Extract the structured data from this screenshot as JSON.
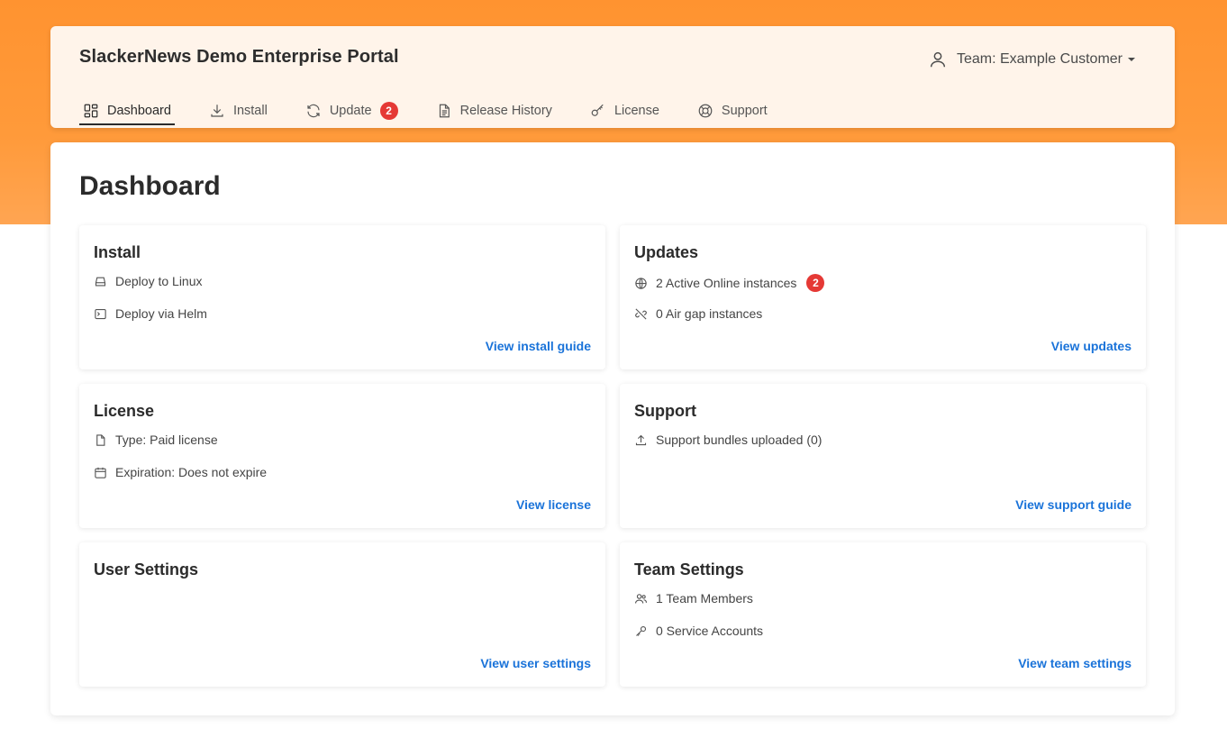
{
  "header": {
    "brand": "SlackerNews Demo Enterprise Portal",
    "team_label": "Team: Example Customer"
  },
  "nav": {
    "dashboard": "Dashboard",
    "install": "Install",
    "update": "Update",
    "update_badge": "2",
    "release_history": "Release History",
    "license": "License",
    "support": "Support"
  },
  "page_title": "Dashboard",
  "cards": {
    "install": {
      "title": "Install",
      "rows": [
        "Deploy to Linux",
        "Deploy via Helm"
      ],
      "link": "View install guide"
    },
    "updates": {
      "title": "Updates",
      "rows": [
        "2 Active Online instances",
        "0 Air gap instances"
      ],
      "badge": "2",
      "link": "View updates"
    },
    "license": {
      "title": "License",
      "rows": [
        "Type: Paid license",
        "Expiration: Does not expire"
      ],
      "link": "View license"
    },
    "support": {
      "title": "Support",
      "rows": [
        "Support bundles uploaded (0)"
      ],
      "link": "View support guide"
    },
    "user_settings": {
      "title": "User Settings",
      "link": "View user settings"
    },
    "team_settings": {
      "title": "Team Settings",
      "rows": [
        "1 Team Members",
        "0 Service Accounts"
      ],
      "link": "View team settings"
    }
  },
  "colors": {
    "accent_orange": "#ff9330",
    "header_bg": "#fff4ea",
    "link_blue": "#1a73d9",
    "badge_red": "#e53935"
  }
}
